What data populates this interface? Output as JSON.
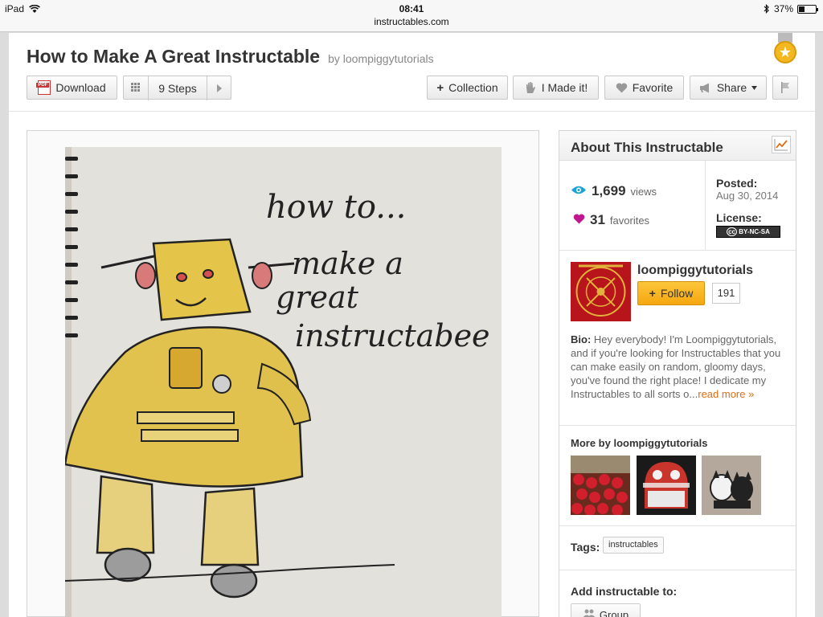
{
  "status_bar": {
    "device": "iPad",
    "time": "08:41",
    "url": "instructables.com",
    "battery": "37%",
    "battery_fraction": 0.37
  },
  "page": {
    "title": "How to Make A Great Instructable",
    "byline": "by loompiggytutorials"
  },
  "toolbar": {
    "download_label": "Download",
    "steps_label": "9 Steps",
    "collection_label": "Collection",
    "made_it_label": "I Made it!",
    "favorite_label": "Favorite",
    "share_label": "Share"
  },
  "photo": {
    "line1": "how to...",
    "line2": "make a",
    "line3": "great",
    "line4": "instructabee"
  },
  "about": {
    "heading": "About This Instructable",
    "views_count": "1,699",
    "views_label": "views",
    "favorites_count": "31",
    "favorites_label": "favorites",
    "posted_label": "Posted:",
    "posted_date": "Aug 30, 2014",
    "license_label": "License:",
    "license_badge": "BY-NC-SA"
  },
  "author": {
    "name": "loompiggytutorials",
    "follow_label": "Follow",
    "followers": "191",
    "bio_label": "Bio:",
    "bio_text": " Hey everybody! I'm Loompiggytutorials, and if you're looking for Instructables that you can make easily on random, gloomy days, you've found the right place! I dedicate my Instructables to all sorts o...",
    "read_more": "read more »"
  },
  "more": {
    "heading": "More by loompiggytutorials"
  },
  "tags": {
    "label": "Tags:",
    "items": [
      "instructables"
    ]
  },
  "add_to": {
    "heading": "Add instructable to:",
    "group_label": "Group"
  },
  "colors": {
    "accent_orange": "#e06d14",
    "follow_yellow": "#f5a70f",
    "views_blue": "#1aa4d8",
    "heart_magenta": "#c0168f"
  }
}
